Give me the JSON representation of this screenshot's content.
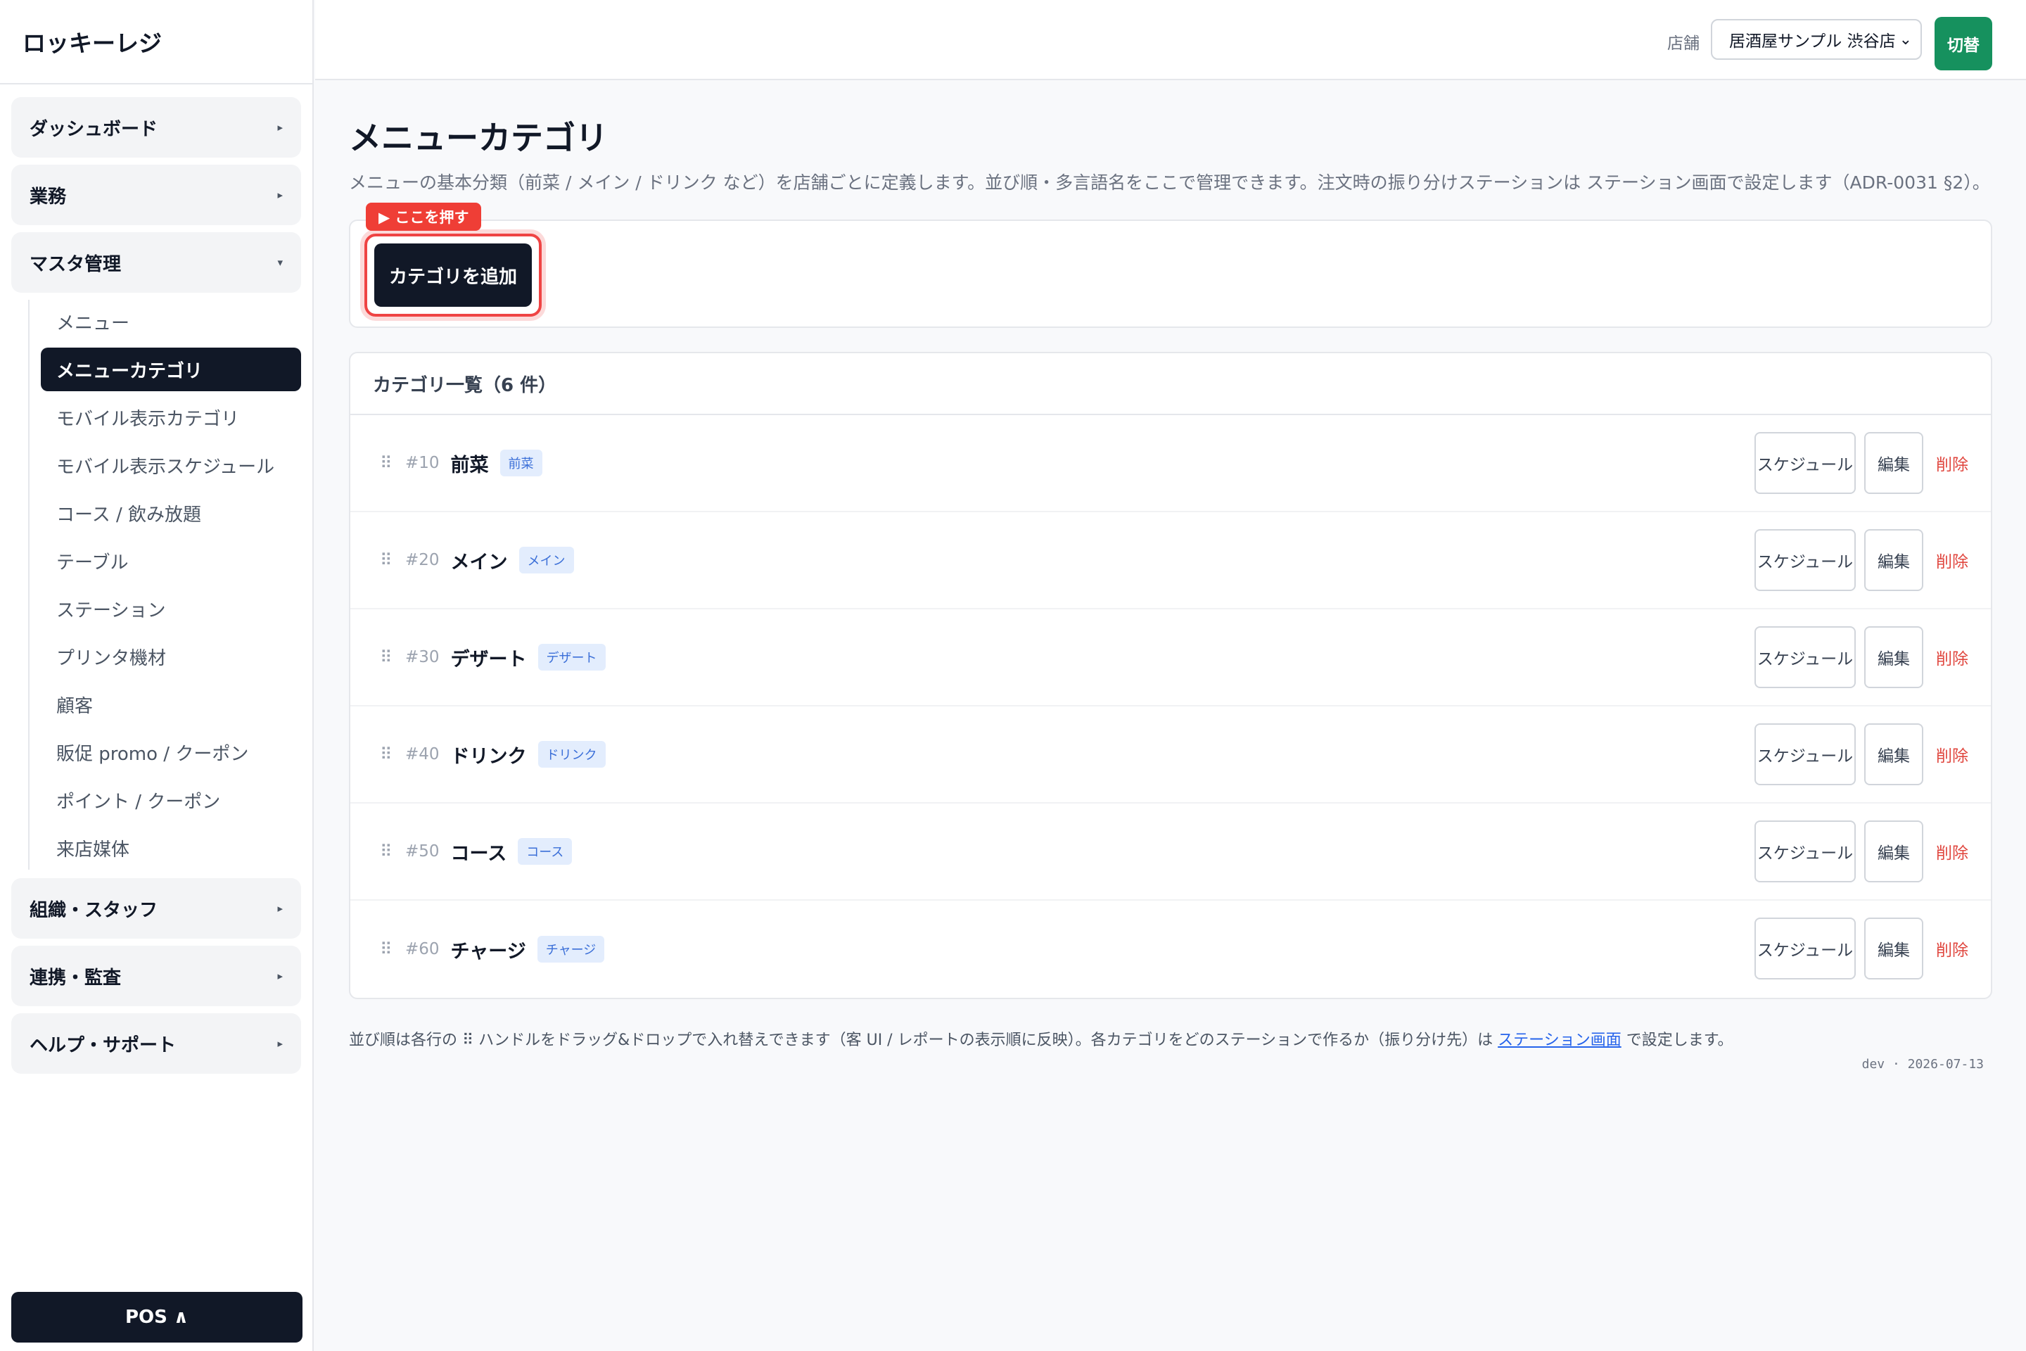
{
  "brand": "ロッキーレジ",
  "sidebar": {
    "groups": [
      {
        "label": "ダッシュボード",
        "caret": "▸"
      },
      {
        "label": "業務",
        "caret": "▸"
      },
      {
        "label": "マスタ管理",
        "caret": "▾"
      },
      {
        "label": "組織・スタッフ",
        "caret": "▸"
      },
      {
        "label": "連携・監査",
        "caret": "▸"
      },
      {
        "label": "ヘルプ・サポート",
        "caret": "▸"
      }
    ],
    "master_items": [
      "メニュー",
      "メニューカテゴリ",
      "モバイル表示カテゴリ",
      "モバイル表示スケジュール",
      "コース / 飲み放題",
      "テーブル",
      "ステーション",
      "プリンタ機材",
      "顧客",
      "販促 promo / クーポン",
      "ポイント / クーポン",
      "来店媒体"
    ],
    "active_item": "メニューカテゴリ",
    "pos_label": "POS ∧"
  },
  "topbar": {
    "store_label": "店舗",
    "store_value": "居酒屋サンプル 渋谷店",
    "switch_label": "切替"
  },
  "page": {
    "title": "メニューカテゴリ",
    "description": "メニューの基本分類（前菜 / メイン / ドリンク など）を店舗ごとに定義します。並び順・多言語名をここで管理できます。注文時の振り分けステーションは ステーション画面で設定します（ADR-0031 §2）。",
    "hint_badge": "▶ ここを押す",
    "add_button": "カテゴリを追加",
    "list_title": "カテゴリ一覧（6 件）"
  },
  "categories": [
    {
      "code": "#10",
      "name": "前菜",
      "tag": "前菜"
    },
    {
      "code": "#20",
      "name": "メイン",
      "tag": "メイン"
    },
    {
      "code": "#30",
      "name": "デザート",
      "tag": "デザート"
    },
    {
      "code": "#40",
      "name": "ドリンク",
      "tag": "ドリンク"
    },
    {
      "code": "#50",
      "name": "コース",
      "tag": "コース"
    },
    {
      "code": "#60",
      "name": "チャージ",
      "tag": "チャージ"
    }
  ],
  "row_actions": {
    "schedule": "スケジュール",
    "edit": "編集",
    "delete": "削除",
    "handle": "⠿"
  },
  "footer": {
    "note_before": "並び順は各行の ⠿ ハンドルをドラッグ&ドロップで入れ替えできます（客 UI / レポートの表示順に反映）。各カテゴリをどのステーションで作るか（振り分け先）は ",
    "note_link": "ステーション画面",
    "note_after": " で設定します。",
    "build_info": "dev · 2026-07-13"
  },
  "colors": {
    "primary_dark": "#111827",
    "accent_green": "#16915e",
    "highlight_red": "#ef4444",
    "tag_blue": "#3b6fd8",
    "delete_red": "#e0473f"
  }
}
